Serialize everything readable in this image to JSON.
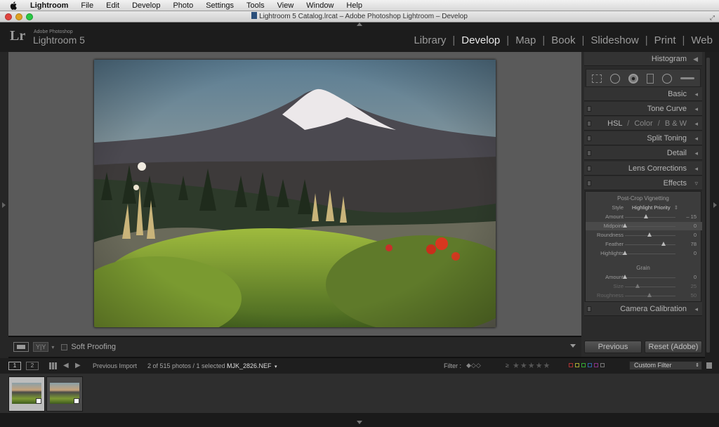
{
  "menubar": {
    "app": "Lightroom",
    "items": [
      "File",
      "Edit",
      "Develop",
      "Photo",
      "Settings",
      "Tools",
      "View",
      "Window",
      "Help"
    ]
  },
  "window": {
    "title": "Lightroom 5 Catalog.lrcat – Adobe Photoshop Lightroom – Develop"
  },
  "identity": {
    "logo": "Lr",
    "brand_small": "Adobe Photoshop",
    "product": "Lightroom 5"
  },
  "modules": {
    "library": "Library",
    "develop": "Develop",
    "map": "Map",
    "book": "Book",
    "slideshow": "Slideshow",
    "print": "Print",
    "web": "Web",
    "separator": "|"
  },
  "panels": {
    "histogram": "Histogram",
    "basic": "Basic",
    "tone_curve": "Tone Curve",
    "hsl": "HSL",
    "color": "Color",
    "bw": "B & W",
    "hsl_sep": "/",
    "split_toning": "Split Toning",
    "detail": "Detail",
    "lens_corrections": "Lens Corrections",
    "effects": "Effects",
    "camera_calibration": "Camera Calibration"
  },
  "effects": {
    "vignette_title": "Post-Crop Vignetting",
    "style_label": "Style",
    "style_value": "Highlight Priority",
    "vignette_sliders": [
      {
        "label": "Amount",
        "value": "– 15",
        "pos": 0.43
      },
      {
        "label": "Midpoint",
        "value": "0",
        "pos": 0.0
      },
      {
        "label": "Roundness",
        "value": "0",
        "pos": 0.5
      },
      {
        "label": "Feather",
        "value": "78",
        "pos": 0.78
      },
      {
        "label": "Highlights",
        "value": "0",
        "pos": 0.0
      }
    ],
    "grain_title": "Grain",
    "grain_sliders": [
      {
        "label": "Amount",
        "value": "0",
        "pos": 0.0
      },
      {
        "label": "Size",
        "value": "25",
        "pos": 0.25
      },
      {
        "label": "Roughness",
        "value": "50",
        "pos": 0.5
      }
    ]
  },
  "toolbar": {
    "view_icon_label": "Y|Y",
    "soft_proofing": "Soft Proofing"
  },
  "buttons": {
    "previous": "Previous",
    "reset": "Reset (Adobe)"
  },
  "filmstrip_bar": {
    "screen1": "1",
    "screen2": "2",
    "source": "Previous Import",
    "count": "2 of 515 photos / 1 selected /",
    "filename": "MJK_2826.NEF",
    "filter_label": "Filter :",
    "rating_op": "≥",
    "stars": "★★★★★",
    "custom_filter": "Custom Filter"
  },
  "colors": {
    "accent_red": "#c8302a",
    "panel_bg": "#2b2b2b",
    "canvas_bg": "#5a5a5a"
  }
}
